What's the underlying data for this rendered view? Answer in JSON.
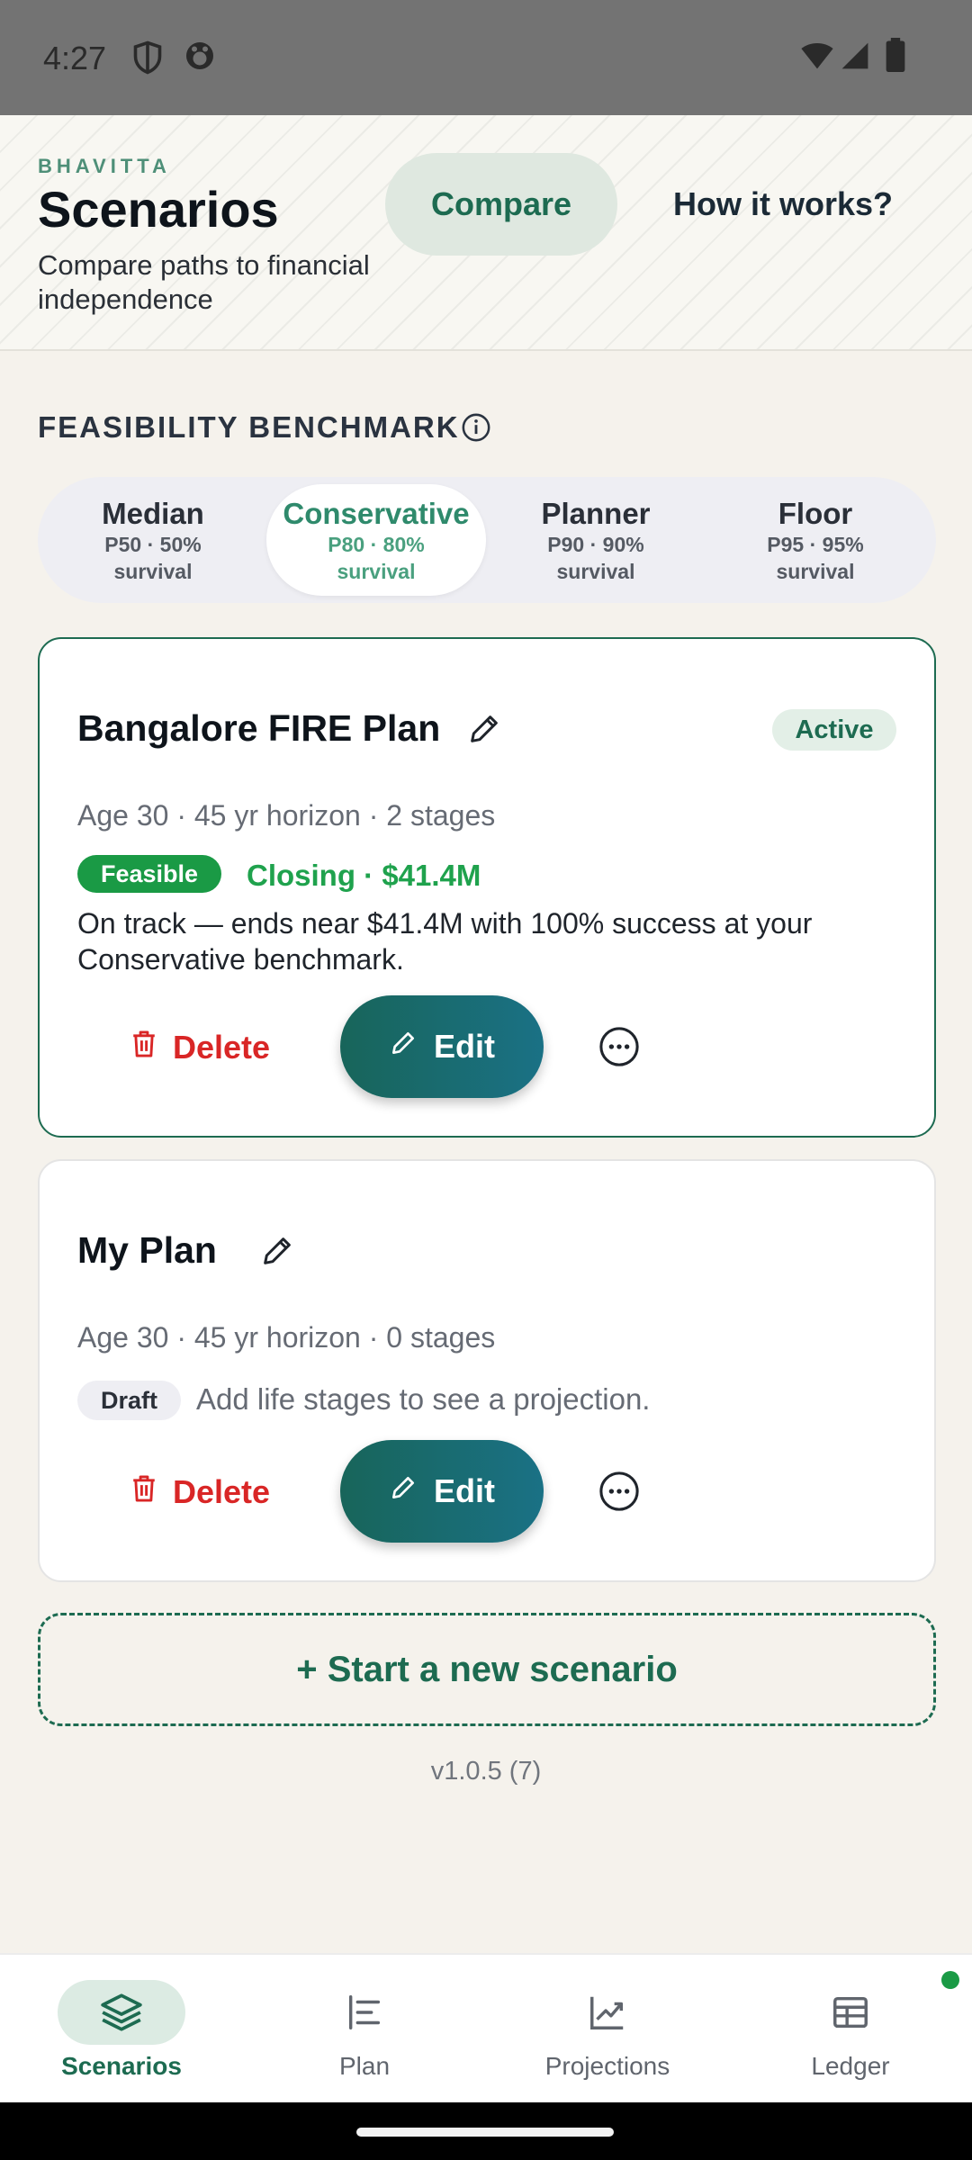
{
  "status_bar": {
    "time": "4:27"
  },
  "header": {
    "brand": "BHAVITTA",
    "title": "Scenarios",
    "subtitle": "Compare paths to financial independence",
    "compare_label": "Compare",
    "how_label": "How it works?"
  },
  "benchmark": {
    "label": "FEASIBILITY BENCHMARK",
    "options": [
      {
        "name": "Median",
        "line1": "P50 · 50%",
        "line2": "survival"
      },
      {
        "name": "Conservative",
        "line1": "P80 · 80%",
        "line2": "survival"
      },
      {
        "name": "Planner",
        "line1": "P90 · 90%",
        "line2": "survival"
      },
      {
        "name": "Floor",
        "line1": "P95 · 95%",
        "line2": "survival"
      }
    ],
    "selected": "Conservative"
  },
  "cards": [
    {
      "name": "Bangalore FIRE Plan",
      "badge": "Active",
      "meta": "Age 30 · 45 yr horizon · 2 stages",
      "status": "Feasible",
      "closing": "Closing · $41.4M",
      "description": "On track — ends near $41.4M with 100% success at your Conservative benchmark.",
      "delete_label": "Delete",
      "edit_label": "Edit"
    },
    {
      "name": "My Plan",
      "meta": "Age 30 · 45 yr horizon · 0 stages",
      "status": "Draft",
      "status_text": "Add life stages to see a projection.",
      "delete_label": "Delete",
      "edit_label": "Edit"
    }
  ],
  "new_scenario_label": "+ Start a new scenario",
  "version": "v1.0.5 (7)",
  "nav": {
    "items": [
      {
        "label": "Scenarios",
        "icon": "layers-icon"
      },
      {
        "label": "Plan",
        "icon": "plan-icon"
      },
      {
        "label": "Projections",
        "icon": "chart-icon"
      },
      {
        "label": "Ledger",
        "icon": "table-icon"
      }
    ],
    "selected": "Scenarios"
  },
  "colors": {
    "brand_green": "#1d6b51",
    "feasible_green": "#1a9a45",
    "delete_red": "#d92626",
    "edit_gradient_start": "#18655a",
    "edit_gradient_end": "#1a7185",
    "background": "#f5f2ec"
  }
}
